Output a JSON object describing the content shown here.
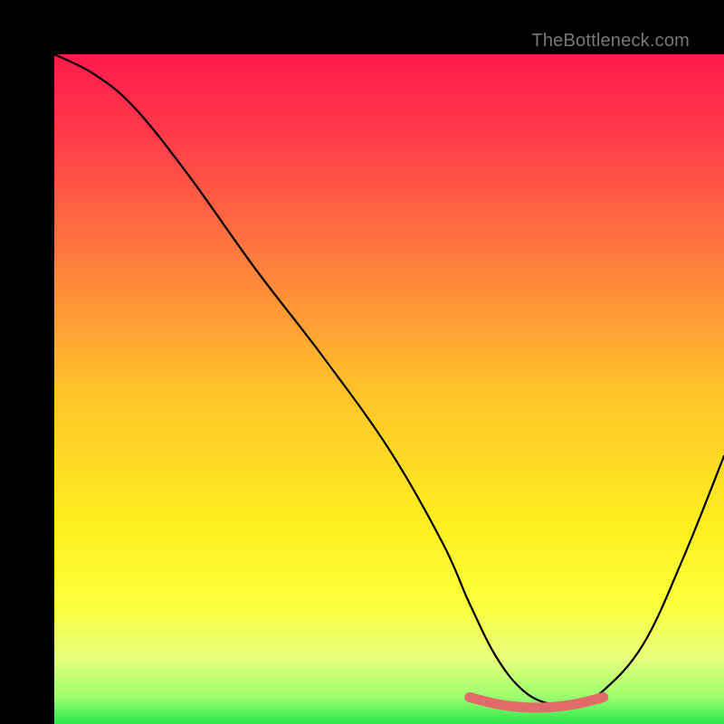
{
  "watermark": "TheBottleneck.com",
  "chart_data": {
    "type": "line",
    "title": "",
    "xlabel": "",
    "ylabel": "",
    "xlim": [
      0,
      100
    ],
    "ylim": [
      0,
      100
    ],
    "series": [
      {
        "name": "bottleneck-curve",
        "x": [
          0,
          6,
          12,
          20,
          30,
          40,
          50,
          58,
          62,
          66,
          70,
          74,
          78,
          82,
          88,
          94,
          100
        ],
        "values": [
          100,
          97,
          92,
          82,
          68,
          55,
          41,
          27,
          18,
          10,
          5,
          3,
          3,
          5,
          12,
          25,
          40
        ]
      }
    ],
    "highlight": {
      "name": "optimal-zone",
      "x": [
        62,
        66,
        70,
        74,
        78,
        82
      ],
      "values": [
        4,
        3,
        2.5,
        2.5,
        3,
        4
      ]
    },
    "gradient_stops": [
      {
        "pos": 0.0,
        "color": "#ff1a4b"
      },
      {
        "pos": 0.12,
        "color": "#ff3a4a"
      },
      {
        "pos": 0.3,
        "color": "#ff7a3e"
      },
      {
        "pos": 0.5,
        "color": "#ffc22a"
      },
      {
        "pos": 0.7,
        "color": "#ffee20"
      },
      {
        "pos": 0.82,
        "color": "#fbff3a"
      },
      {
        "pos": 0.9,
        "color": "#e8ff7a"
      },
      {
        "pos": 0.96,
        "color": "#9cff6e"
      },
      {
        "pos": 1.0,
        "color": "#28e84c"
      }
    ]
  }
}
